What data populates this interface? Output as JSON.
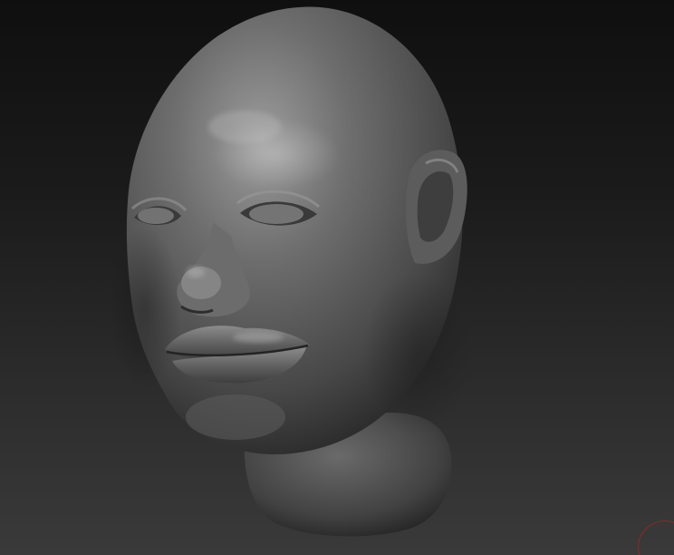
{
  "viewport": {
    "background_top": "#0f0f0f",
    "background_bottom": "#3a3a3a",
    "material_color": "#6a6a6a"
  },
  "model": {
    "icon": "sculpted-head-model"
  },
  "gizmo": {
    "icon": "navigation-gizmo-icon",
    "color": "#8a2a2a"
  }
}
